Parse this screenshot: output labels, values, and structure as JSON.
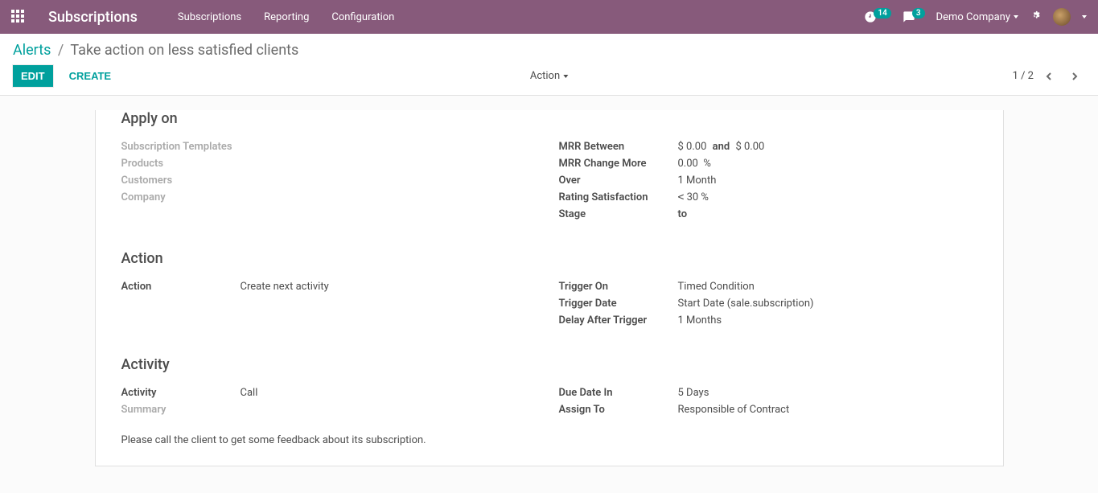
{
  "navbar": {
    "brand": "Subscriptions",
    "menu": [
      "Subscriptions",
      "Reporting",
      "Configuration"
    ],
    "activities_count": "14",
    "messages_count": "3",
    "company": "Demo Company"
  },
  "breadcrumb": {
    "parent": "Alerts",
    "current": "Take action on less satisfied clients"
  },
  "cp": {
    "edit": "EDIT",
    "create": "CREATE",
    "action": "Action",
    "pager": "1 / 2"
  },
  "sections": {
    "apply_on": {
      "title": "Apply on",
      "left": {
        "subscription_templates_label": "Subscription Templates",
        "products_label": "Products",
        "customers_label": "Customers",
        "company_label": "Company"
      },
      "right": {
        "mrr_between_label": "MRR Between",
        "mrr_from": "$ 0.00",
        "mrr_and": "and",
        "mrr_to": "$ 0.00",
        "mrr_change_label": "MRR Change More",
        "mrr_change_value": "0.00",
        "mrr_change_unit": "%",
        "over_label": "Over",
        "over_value": "1 Month",
        "rating_label": "Rating Satisfaction",
        "rating_op": "<",
        "rating_value": "30",
        "rating_unit": "%",
        "stage_label": "Stage",
        "stage_to": "to"
      }
    },
    "action": {
      "title": "Action",
      "left": {
        "action_label": "Action",
        "action_value": "Create next activity"
      },
      "right": {
        "trigger_on_label": "Trigger On",
        "trigger_on_value": "Timed Condition",
        "trigger_date_label": "Trigger Date",
        "trigger_date_value": "Start Date (sale.subscription)",
        "delay_label": "Delay After Trigger",
        "delay_value": "1",
        "delay_unit": "Months"
      }
    },
    "activity": {
      "title": "Activity",
      "left": {
        "activity_label": "Activity",
        "activity_value": "Call",
        "summary_label": "Summary"
      },
      "right": {
        "due_label": "Due Date In",
        "due_value": "5",
        "due_unit": "Days",
        "assign_label": "Assign To",
        "assign_value": "Responsible of Contract"
      },
      "note": "Please call the client to get some feedback about its subscription."
    }
  }
}
